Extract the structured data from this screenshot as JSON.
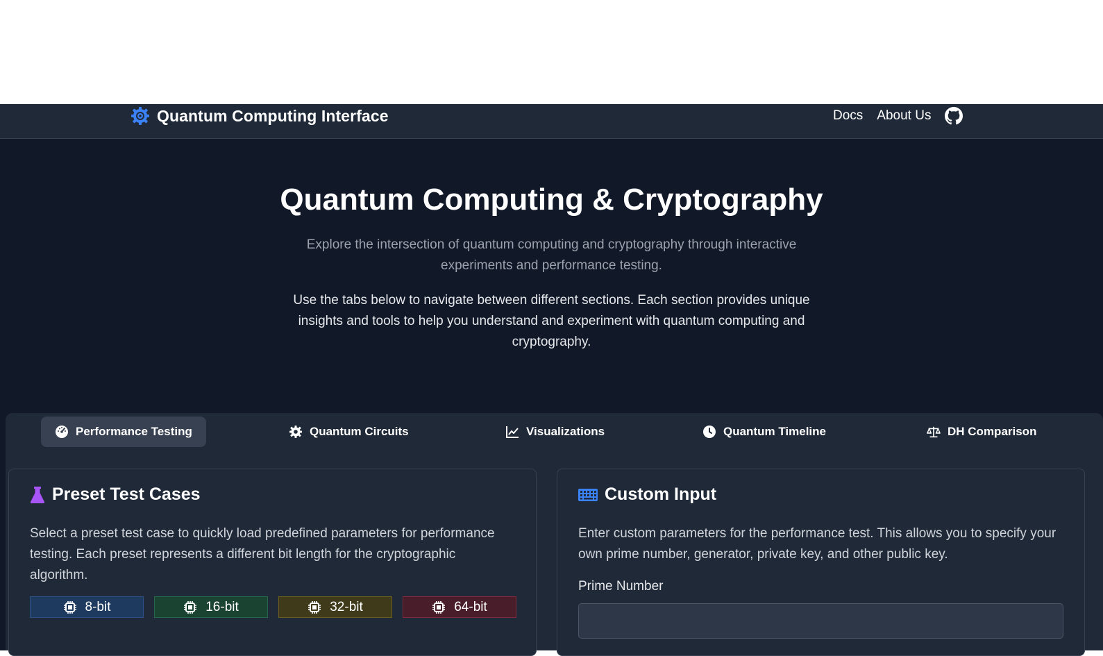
{
  "navbar": {
    "brand_title": "Quantum Computing Interface",
    "brand_icon": "atom-gear-icon",
    "links": [
      "Docs",
      "About Us"
    ],
    "github_icon": "github-icon"
  },
  "hero": {
    "title": "Quantum Computing & Cryptography",
    "subtitle": "Explore the intersection of quantum computing and cryptography through interactive experiments and performance testing.",
    "description": "Use the tabs below to navigate between different sections. Each section provides unique insights and tools to help you understand and experiment with quantum computing and cryptography."
  },
  "tabs": [
    {
      "label": "Performance Testing",
      "icon": "gauge-icon",
      "active": true
    },
    {
      "label": "Quantum Circuits",
      "icon": "gear-icon",
      "active": false
    },
    {
      "label": "Visualizations",
      "icon": "line-chart-icon",
      "active": false
    },
    {
      "label": "Quantum Timeline",
      "icon": "clock-icon",
      "active": false
    },
    {
      "label": "DH Comparison",
      "icon": "scale-icon",
      "active": false
    }
  ],
  "preset_card": {
    "title": "Preset Test Cases",
    "icon": "flask-icon",
    "text": "Select a preset test case to quickly load predefined parameters for performance testing. Each preset represents a different bit length for the cryptographic algorithm.",
    "presets": [
      {
        "label": "8-bit",
        "icon": "chip-icon"
      },
      {
        "label": "16-bit",
        "icon": "chip-icon"
      },
      {
        "label": "32-bit",
        "icon": "chip-icon"
      },
      {
        "label": "64-bit",
        "icon": "chip-icon"
      }
    ]
  },
  "custom_card": {
    "title": "Custom Input",
    "icon": "keyboard-icon",
    "text": "Enter custom parameters for the performance test. This allows you to specify your own prime number, generator, private key, and other public key.",
    "prime_label": "Prime Number",
    "prime_value": ""
  },
  "colors": {
    "background": "#111827",
    "panel": "#1f2937",
    "brand_icon": "#3b82f6",
    "flask_icon": "#a855f7",
    "keyboard_icon": "#3b82f6"
  }
}
